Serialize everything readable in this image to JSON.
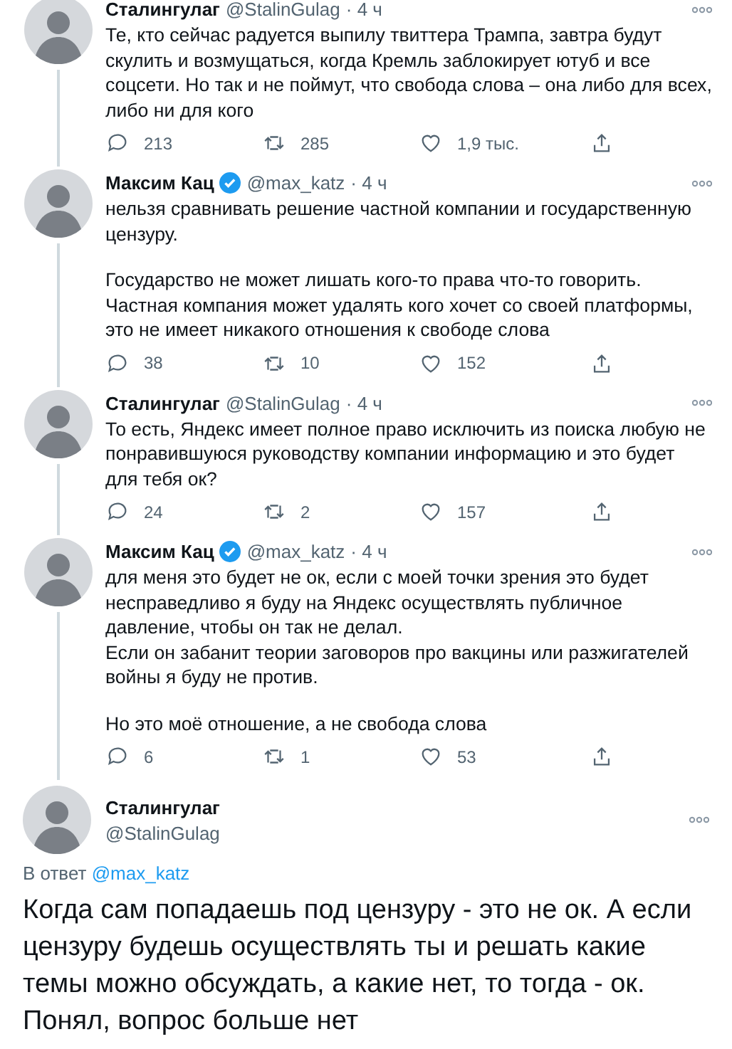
{
  "thread": [
    {
      "author": "Сталингулаг",
      "handle": "@StalinGulag",
      "time": "· 4 ч",
      "verified": false,
      "paragraphs": [
        "Те, кто сейчас радуется выпилу твиттера Трампа, завтра будут скулить и возмущаться, когда Кремль заблокирует ютуб и все соцсети. Но так и не поймут, что свобода слова – она либо для всех, либо ни для кого"
      ],
      "replies": "213",
      "retweets": "285",
      "likes": "1,9 тыс."
    },
    {
      "author": "Максим Кац",
      "handle": "@max_katz",
      "time": "· 4 ч",
      "verified": true,
      "paragraphs": [
        "нельзя сравнивать решение частной компании и государственную цензуру.",
        "Государство не может лишать кого-то права что-то говорить. Частная компания может удалять кого хочет со своей платформы, это не имеет никакого отношения к свободе слова"
      ],
      "replies": "38",
      "retweets": "10",
      "likes": "152"
    },
    {
      "author": "Сталингулаг",
      "handle": "@StalinGulag",
      "time": "· 4 ч",
      "verified": false,
      "paragraphs": [
        "То есть, Яндекс имеет полное право исключить из поиска любую не понравившуюся руководству компании информацию и это будет для тебя ок?"
      ],
      "replies": "24",
      "retweets": "2",
      "likes": "157"
    },
    {
      "author": "Максим Кац",
      "handle": "@max_katz",
      "time": "· 4 ч",
      "verified": true,
      "paragraphs": [
        "для меня это будет не ок, если с моей точки зрения это будет несправедливо я буду на Яндекс осуществлять публичное давление, чтобы он так не делал.\nЕсли он забанит теории заговоров про вакцины или разжигателей войны я буду не против.",
        "Но это моё отношение, а не свобода слова"
      ],
      "replies": "6",
      "retweets": "1",
      "likes": "53"
    }
  ],
  "main_tweet": {
    "author": "Сталингулаг",
    "handle": "@StalinGulag",
    "reply_label": "В ответ",
    "reply_to": "@max_katz",
    "text": "Когда сам попадаешь под цензуру - это не ок. А если цензуру будешь осуществлять ты и решать какие темы можно обсуждать, а какие нет, то тогда - ок. Понял, вопрос больше нет"
  }
}
